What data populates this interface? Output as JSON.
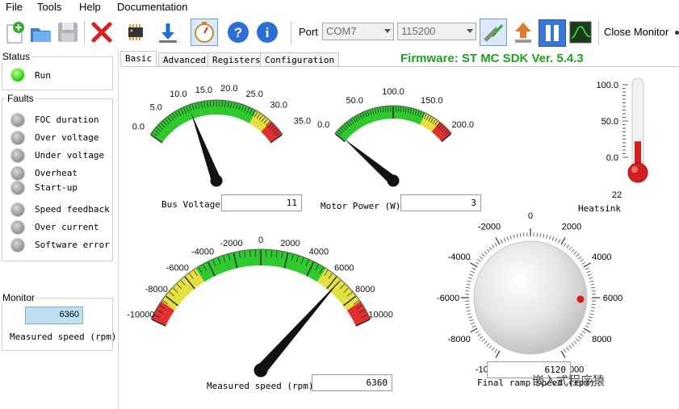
{
  "menu": [
    "File",
    "Tools",
    "Help",
    "Documentation"
  ],
  "toolbar": {
    "icons": [
      "new-icon",
      "open-icon",
      "save-icon",
      "delete-icon",
      "chip-icon",
      "download-icon",
      "stopwatch-icon",
      "help-icon",
      "info-icon"
    ],
    "port_label": "Port",
    "port_value": "COM7",
    "baud_value": "115200",
    "close_monitor_label": "Close Monitor"
  },
  "status": {
    "group_title": "Status",
    "run_label": "Run",
    "colors": {
      "run_led": "#3ed61e"
    }
  },
  "faults": {
    "group_title": "Faults",
    "items": [
      "FOC duration",
      "Over voltage",
      "Under voltage",
      "Overheat",
      "Start-up",
      "Speed feedback",
      "Over current",
      "Software error"
    ]
  },
  "monitor": {
    "group_title": "Monitor",
    "value": "6360",
    "label": "Measured speed (rpm)"
  },
  "tabs": [
    "Basic",
    "Advanced",
    "Registers",
    "Configuration"
  ],
  "firmware": "Firmware: ST MC SDK Ver. 5.4.3",
  "gauges": {
    "bus_voltage": {
      "label": "Bus Voltage",
      "value": "11",
      "ticks": [
        "0.0",
        "5.0",
        "10.0",
        "15.0",
        "20.0",
        "25.0",
        "30.0",
        "35.0"
      ],
      "min": 0,
      "max": 35,
      "needle": 11
    },
    "motor_power": {
      "label": "Motor Power (W)",
      "value": "3",
      "ticks": [
        "0.0",
        "50.0",
        "100.0",
        "150.0",
        "200.0"
      ],
      "min": 0,
      "max": 200,
      "needle": 3
    },
    "measured_speed": {
      "label": "Measured speed (rpm)",
      "value": "6360",
      "ticks": [
        "-10000",
        "-8000",
        "-6000",
        "-4000",
        "-2000",
        "0",
        "2000",
        "4000",
        "6000",
        "8000",
        "10000"
      ],
      "min": -10000,
      "max": 10000,
      "needle": 6360
    }
  },
  "heatsink": {
    "label": "Heatsink",
    "value": "22",
    "ticks": [
      "100.0",
      "50.0",
      "0.0"
    ],
    "level": 22
  },
  "knob": {
    "label": "Final ramp speed (rpm)",
    "value": "6120",
    "ticks": [
      "0",
      "2000",
      "4000",
      "6000",
      "8000",
      "10000",
      "-2000",
      "-4000",
      "-6000",
      "-8000",
      "-10000"
    ]
  },
  "watermark": "嵌入式程序猿"
}
